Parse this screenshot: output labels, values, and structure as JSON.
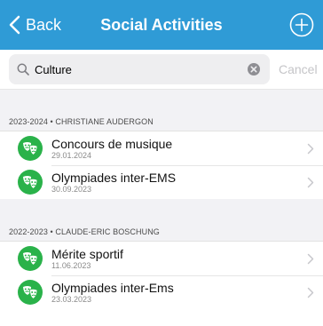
{
  "colors": {
    "accent": "#2f9bd6",
    "icon_green": "#2ab24a",
    "background_gray": "#f2f2f5"
  },
  "navbar": {
    "back_label": "Back",
    "back_icon": "chevron-left-icon",
    "title": "Social Activities",
    "add_icon": "plus-circle-icon"
  },
  "search": {
    "value": "Culture",
    "icon": "search-icon",
    "clear_icon": "clear-icon",
    "cancel_label": "Cancel"
  },
  "sections": [
    {
      "header": "2023-2024 • CHRISTIANE AUDERGON",
      "items": [
        {
          "title": "Concours de musique",
          "date": "29.01.2024",
          "icon": "theater-masks-icon"
        },
        {
          "title": "Olympiades inter-EMS",
          "date": "30.09.2023",
          "icon": "theater-masks-icon"
        }
      ]
    },
    {
      "header": "2022-2023 • CLAUDE-ERIC BOSCHUNG",
      "items": [
        {
          "title": "Mérite sportif",
          "date": "11.06.2023",
          "icon": "theater-masks-icon"
        },
        {
          "title": "Olympiades inter-Ems",
          "date": "23.03.2023",
          "icon": "theater-masks-icon"
        }
      ]
    }
  ]
}
